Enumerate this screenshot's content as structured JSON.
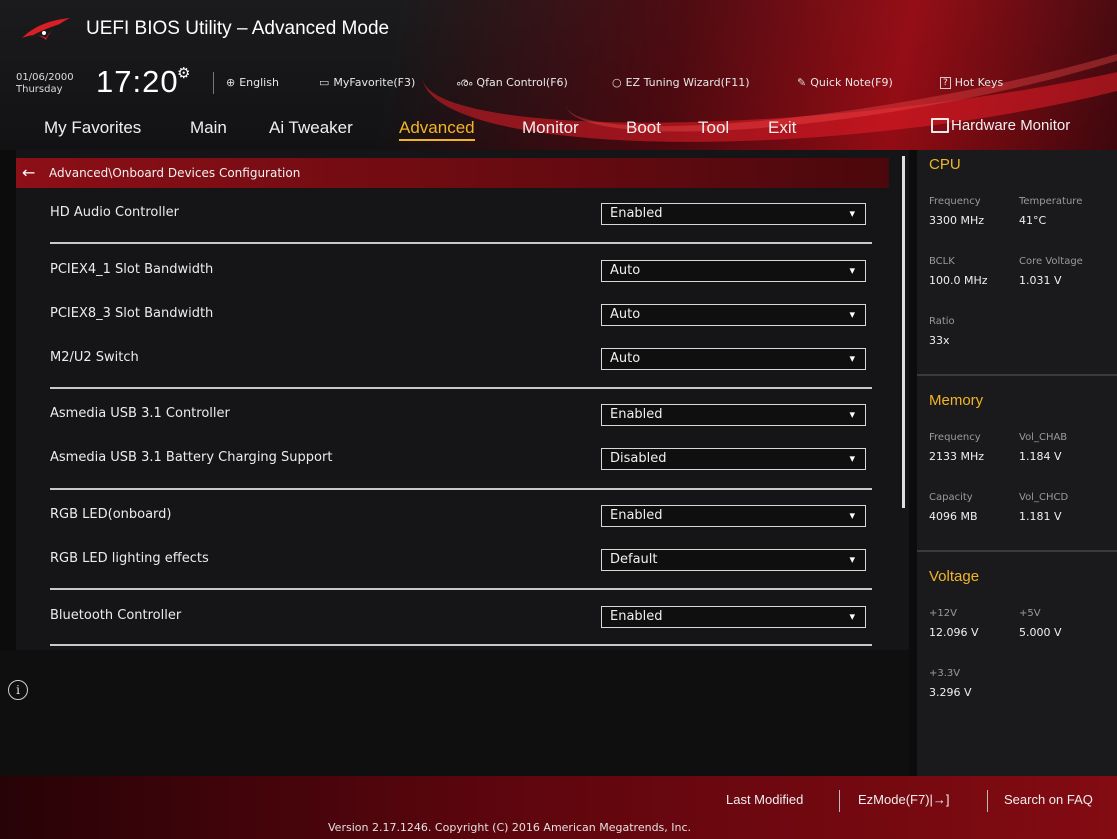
{
  "app": {
    "title": "UEFI BIOS Utility – Advanced Mode"
  },
  "clock": {
    "date": "01/06/2000",
    "day": "Thursday",
    "time": "17:20"
  },
  "toolbar": {
    "english": "English",
    "myfavorite": "MyFavorite(F3)",
    "qfan": "Qfan Control(F6)",
    "ez_tuning": "EZ Tuning Wizard(F11)",
    "quick_note": "Quick Note(F9)",
    "hot_keys": "Hot Keys",
    "hot_keys_box": "?"
  },
  "tabs": [
    {
      "label": "My Favorites"
    },
    {
      "label": "Main"
    },
    {
      "label": "Ai Tweaker"
    },
    {
      "label": "Advanced",
      "active": true
    },
    {
      "label": "Monitor"
    },
    {
      "label": "Boot"
    },
    {
      "label": "Tool"
    },
    {
      "label": "Exit"
    }
  ],
  "breadcrumb": "Advanced\\Onboard Devices Configuration",
  "settings": [
    {
      "label": "HD Audio Controller",
      "value": "Enabled"
    },
    {
      "label": "PCIEX4_1 Slot Bandwidth",
      "value": "Auto"
    },
    {
      "label": "PCIEX8_3 Slot Bandwidth",
      "value": "Auto"
    },
    {
      "label": "M2/U2 Switch",
      "value": "Auto"
    },
    {
      "label": "Asmedia USB 3.1 Controller",
      "value": "Enabled"
    },
    {
      "label": "Asmedia USB 3.1 Battery Charging Support",
      "value": "Disabled"
    },
    {
      "label": "RGB LED(onboard)",
      "value": "Enabled"
    },
    {
      "label": "RGB LED lighting effects",
      "value": "Default"
    },
    {
      "label": "Bluetooth Controller",
      "value": "Enabled"
    }
  ],
  "hw_monitor": {
    "title": "Hardware Monitor",
    "cpu": {
      "title": "CPU",
      "frequency_label": "Frequency",
      "frequency": "3300 MHz",
      "temperature_label": "Temperature",
      "temperature": "41°C",
      "bclk_label": "BCLK",
      "bclk": "100.0 MHz",
      "core_voltage_label": "Core Voltage",
      "core_voltage": "1.031 V",
      "ratio_label": "Ratio",
      "ratio": "33x"
    },
    "memory": {
      "title": "Memory",
      "frequency_label": "Frequency",
      "frequency": "2133 MHz",
      "vol_chab_label": "Vol_CHAB",
      "vol_chab": "1.184 V",
      "capacity_label": "Capacity",
      "capacity": "4096 MB",
      "vol_chcd_label": "Vol_CHCD",
      "vol_chcd": "1.181 V"
    },
    "voltage": {
      "title": "Voltage",
      "v12_label": "+12V",
      "v12": "12.096 V",
      "v5_label": "+5V",
      "v5": "5.000 V",
      "v33_label": "+3.3V",
      "v33": "3.296 V"
    }
  },
  "footer": {
    "last_modified": "Last Modified",
    "ezmode": "EzMode(F7)|→]",
    "search_faq": "Search on FAQ",
    "version": "Version 2.17.1246. Copyright (C) 2016 American Megatrends, Inc."
  },
  "icons": {
    "gear": "⚙",
    "globe": "⊕",
    "fan": "ൟ",
    "bulb": "💡",
    "note": "✎",
    "back_arrow": "←",
    "info": "i",
    "caret": "▾"
  }
}
